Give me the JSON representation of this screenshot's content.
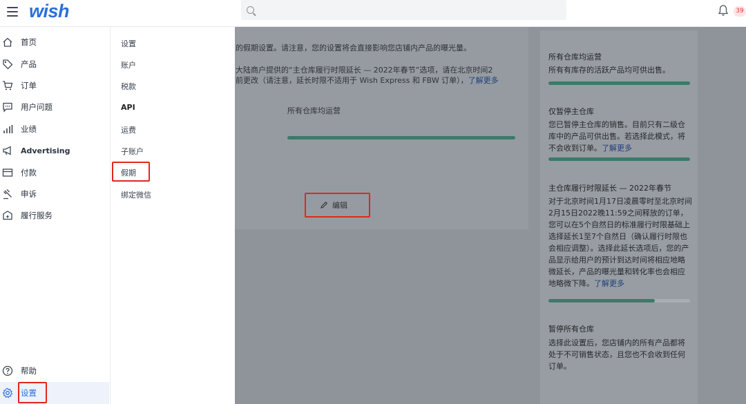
{
  "header": {
    "logo": "wish",
    "notification_count": "39"
  },
  "sidebar": {
    "items": [
      {
        "label": "首页",
        "icon": "home-icon"
      },
      {
        "label": "产品",
        "icon": "tag-icon"
      },
      {
        "label": "订单",
        "icon": "cart-icon"
      },
      {
        "label": "用户问题",
        "icon": "chat-icon"
      },
      {
        "label": "业绩",
        "icon": "bar-chart-icon"
      },
      {
        "label": "Advertising",
        "icon": "megaphone-icon"
      },
      {
        "label": "付款",
        "icon": "card-icon"
      },
      {
        "label": "申诉",
        "icon": "gavel-icon"
      },
      {
        "label": "履行服务",
        "icon": "box-icon"
      }
    ],
    "help_label": "帮助",
    "settings_label": "设置"
  },
  "submenu": {
    "items": [
      "设置",
      "账户",
      "税款",
      "API",
      "运费",
      "子账户",
      "假期",
      "绑定微信"
    ]
  },
  "main": {
    "intro_line1": "的假期设置。请注意，您的设置将会直接影响您店铺内产品的曝光量。",
    "intro_line2": "大陆商户提供的“主仓库履行时限延长 — 2022年春节”选项，请在北京时间2",
    "intro_line3": "前更改（请注意，延长时限不适用于 Wish Express 和 FBW 订单），",
    "learn_more": "了解更多",
    "current_option": "所有仓库均运营",
    "edit_label": "编辑"
  },
  "options": {
    "all_title": "所有仓库均运营",
    "all_desc": "所有有库存的活跃产品均可供出售。",
    "pause_main_title": "仅暂停主仓库",
    "pause_main_desc": "您已暂停主仓库的销售。目前只有二级仓库中的产品可供出售。若选择此模式，将不会收到订单。",
    "pause_main_link": "了解更多",
    "extend_title": "主仓库履行时限延长 — 2022年春节",
    "extend_desc": "对于北京时间1月17日凌晨零时至北京时间2月15日2022晚11:59之间释放的订单，您可以在5个自然日的标准履行时限基础上选择延长1至7个自然日（确认履行时限也会相应调整）。选择此延长选项后，您的产品显示给用户的预计到达时间将相应地略微延长，产品的曝光量和转化率也会相应地略微下降。",
    "extend_link": "了解更多",
    "extend_progress": 0.75,
    "pause_all_title": "暂停所有仓库",
    "pause_all_desc": "选择此设置后，您店铺内的所有产品都将处于不可销售状态，且您也不会收到任何订单。"
  },
  "colors": {
    "brand": "#2a6fdb",
    "highlight": "#e0271d",
    "progress": "#3c7a6a"
  }
}
